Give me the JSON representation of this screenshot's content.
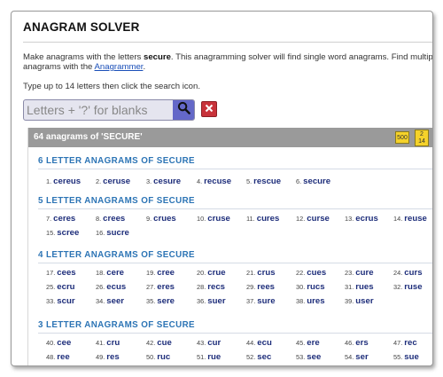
{
  "page": {
    "title": "ANAGRAM SOLVER",
    "intro_prefix": "Make anagrams with the letters ",
    "intro_letters": "secure",
    "intro_middle": ". This anagramming solver will find single word anagrams. Find multip",
    "intro_line2_prefix": "anagrams with the ",
    "intro_link": "Anagrammer",
    "intro_line2_suffix": ".",
    "instructions": "Type up to 14 letters then click the search icon."
  },
  "search": {
    "placeholder": "Letters + '?' for blanks",
    "value": ""
  },
  "results": {
    "title": "64 anagrams of 'SECURE'",
    "badge_a": "500",
    "badge_b_line1": "2",
    "badge_b_line2": "14"
  },
  "sections": [
    {
      "heading": "6 LETTER ANAGRAMS OF SECURE",
      "words": [
        {
          "n": "1.",
          "w": "cereus"
        },
        {
          "n": "2.",
          "w": "ceruse"
        },
        {
          "n": "3.",
          "w": "cesure"
        },
        {
          "n": "4.",
          "w": "recuse"
        },
        {
          "n": "5.",
          "w": "rescue"
        },
        {
          "n": "6.",
          "w": "secure"
        }
      ]
    },
    {
      "heading": "5 LETTER ANAGRAMS OF SECURE",
      "words": [
        {
          "n": "7.",
          "w": "ceres"
        },
        {
          "n": "8.",
          "w": "crees"
        },
        {
          "n": "9.",
          "w": "crues"
        },
        {
          "n": "10.",
          "w": "cruse"
        },
        {
          "n": "11.",
          "w": "cures"
        },
        {
          "n": "12.",
          "w": "curse"
        },
        {
          "n": "13.",
          "w": "ecrus"
        },
        {
          "n": "14.",
          "w": "reuse"
        },
        {
          "n": "15.",
          "w": "scree"
        },
        {
          "n": "16.",
          "w": "sucre"
        }
      ]
    },
    {
      "heading": "4 LETTER ANAGRAMS OF SECURE",
      "words": [
        {
          "n": "17.",
          "w": "cees"
        },
        {
          "n": "18.",
          "w": "cere"
        },
        {
          "n": "19.",
          "w": "cree"
        },
        {
          "n": "20.",
          "w": "crue"
        },
        {
          "n": "21.",
          "w": "crus"
        },
        {
          "n": "22.",
          "w": "cues"
        },
        {
          "n": "23.",
          "w": "cure"
        },
        {
          "n": "24.",
          "w": "curs"
        },
        {
          "n": "25.",
          "w": "ecru"
        },
        {
          "n": "26.",
          "w": "ecus"
        },
        {
          "n": "27.",
          "w": "eres"
        },
        {
          "n": "28.",
          "w": "recs"
        },
        {
          "n": "29.",
          "w": "rees"
        },
        {
          "n": "30.",
          "w": "rucs"
        },
        {
          "n": "31.",
          "w": "rues"
        },
        {
          "n": "32.",
          "w": "ruse"
        },
        {
          "n": "33.",
          "w": "scur"
        },
        {
          "n": "34.",
          "w": "seer"
        },
        {
          "n": "35.",
          "w": "sere"
        },
        {
          "n": "36.",
          "w": "suer"
        },
        {
          "n": "37.",
          "w": "sure"
        },
        {
          "n": "38.",
          "w": "ures"
        },
        {
          "n": "39.",
          "w": "user"
        }
      ]
    },
    {
      "heading": "3 LETTER ANAGRAMS OF SECURE",
      "words": [
        {
          "n": "40.",
          "w": "cee"
        },
        {
          "n": "41.",
          "w": "cru"
        },
        {
          "n": "42.",
          "w": "cue"
        },
        {
          "n": "43.",
          "w": "cur"
        },
        {
          "n": "44.",
          "w": "ecu"
        },
        {
          "n": "45.",
          "w": "ere"
        },
        {
          "n": "46.",
          "w": "ers"
        },
        {
          "n": "47.",
          "w": "rec"
        },
        {
          "n": "48.",
          "w": "ree"
        },
        {
          "n": "49.",
          "w": "res"
        },
        {
          "n": "50.",
          "w": "ruc"
        },
        {
          "n": "51.",
          "w": "rue"
        },
        {
          "n": "52.",
          "w": "sec"
        },
        {
          "n": "53.",
          "w": "see"
        },
        {
          "n": "54.",
          "w": "ser"
        },
        {
          "n": "55.",
          "w": "sue"
        }
      ]
    }
  ],
  "colors": {
    "section_heading": "#2c74b5",
    "word": "#1d2d7a",
    "search_button": "#6468c8",
    "clear_button": "#c8323a",
    "badge": "#f5d22a"
  },
  "icons": {
    "search": "magnifier-icon",
    "clear": "close-x-icon"
  }
}
